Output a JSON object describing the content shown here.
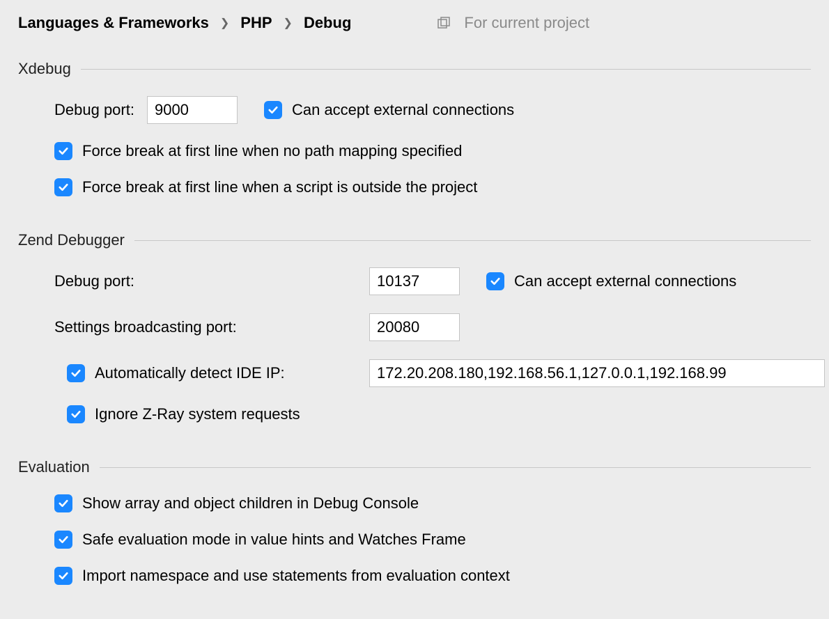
{
  "breadcrumb": {
    "part1": "Languages & Frameworks",
    "part2": "PHP",
    "part3": "Debug"
  },
  "scope_label": "For current project",
  "xdebug": {
    "title": "Xdebug",
    "debug_port_label": "Debug port:",
    "debug_port_value": "9000",
    "accept_external_label": "Can accept external connections",
    "force_break_no_mapping": "Force break at first line when no path mapping specified",
    "force_break_outside": "Force break at first line when a script is outside the project"
  },
  "zend": {
    "title": "Zend Debugger",
    "debug_port_label": "Debug port:",
    "debug_port_value": "10137",
    "accept_external_label": "Can accept external connections",
    "broadcast_port_label": "Settings broadcasting port:",
    "broadcast_port_value": "20080",
    "auto_detect_ip_label": "Automatically detect IDE IP:",
    "ide_ip_value": "172.20.208.180,192.168.56.1,127.0.0.1,192.168.99",
    "ignore_zray_label": "Ignore Z-Ray system requests"
  },
  "eval": {
    "title": "Evaluation",
    "show_array": "Show array and object children in Debug Console",
    "safe_eval": "Safe evaluation mode in value hints and Watches Frame",
    "import_ns": "Import namespace and use statements from evaluation context"
  }
}
